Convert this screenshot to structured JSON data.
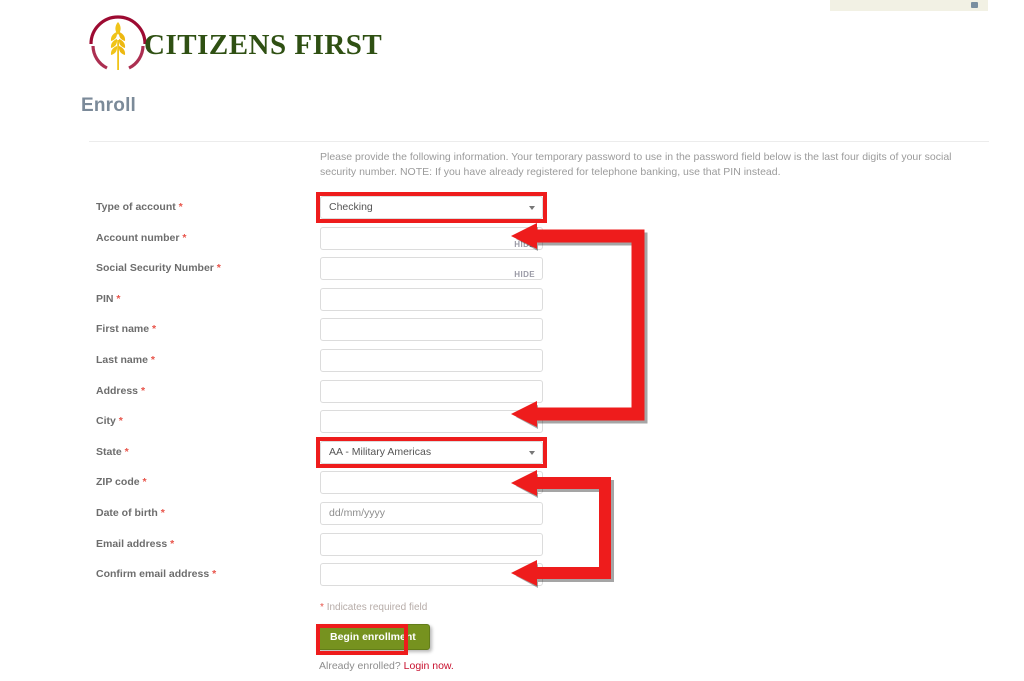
{
  "brand": {
    "name": "CITIZENS FIRST",
    "logo_icon": "wheat-stalk-in-arc-logo",
    "arc_color": "#9d0b32",
    "wheat_color": "#f0c419",
    "name_color": "#2f5013"
  },
  "page": {
    "title": "Enroll",
    "intro": "Please provide the following information. Your temporary password to use in the password field below is the last four digits of your social security number. NOTE: If you have already registered for telephone banking, use that PIN instead."
  },
  "form": {
    "fields": [
      {
        "label": "Type of account",
        "required": true,
        "type": "select",
        "value": "Checking",
        "highlighted": true
      },
      {
        "label": "Account number",
        "required": true,
        "type": "text",
        "value": "",
        "hide_label": "HIDE"
      },
      {
        "label": "Social Security Number",
        "required": true,
        "type": "text",
        "value": "",
        "hide_label": "HIDE"
      },
      {
        "label": "PIN",
        "required": true,
        "type": "text",
        "value": ""
      },
      {
        "label": "First name",
        "required": true,
        "type": "text",
        "value": ""
      },
      {
        "label": "Last name",
        "required": true,
        "type": "text",
        "value": ""
      },
      {
        "label": "Address",
        "required": true,
        "type": "text",
        "value": ""
      },
      {
        "label": "City",
        "required": true,
        "type": "text",
        "value": ""
      },
      {
        "label": "State",
        "required": true,
        "type": "select",
        "value": "AA - Military Americas",
        "highlighted": true
      },
      {
        "label": "ZIP code",
        "required": true,
        "type": "text",
        "value": ""
      },
      {
        "label": "Date of birth",
        "required": true,
        "type": "text",
        "value": "",
        "placeholder": "dd/mm/yyyy"
      },
      {
        "label": "Email address",
        "required": true,
        "type": "text",
        "value": ""
      },
      {
        "label": "Confirm email address",
        "required": true,
        "type": "text",
        "value": ""
      }
    ],
    "required_note": "Indicates required field",
    "required_star": "*",
    "submit_label": "Begin enrollment",
    "footer_prefix": "Already enrolled? ",
    "footer_link": "Login now."
  },
  "annotations": {
    "accent_color": "#ee1c1c",
    "arrow_1": "bracket-arrow-account-number-to-city",
    "arrow_2": "bracket-arrow-zip-to-confirm-email"
  }
}
